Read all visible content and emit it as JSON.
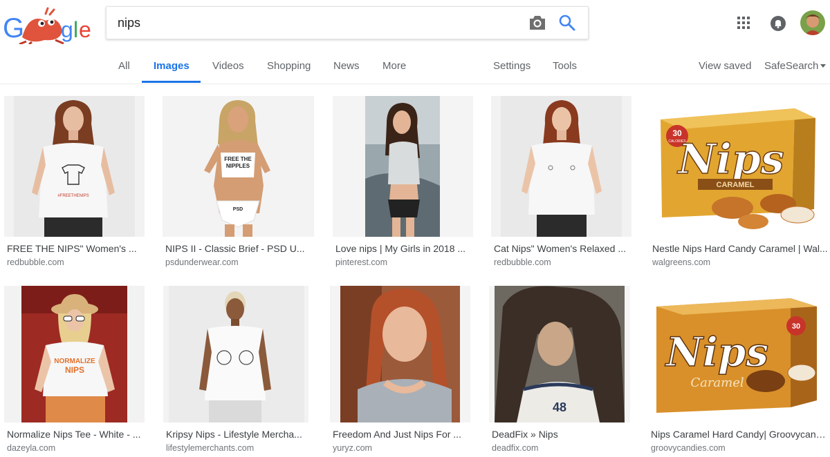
{
  "search": {
    "query": "nips"
  },
  "nav": {
    "tabs": [
      {
        "label": "All"
      },
      {
        "label": "Images"
      },
      {
        "label": "Videos"
      },
      {
        "label": "Shopping"
      },
      {
        "label": "News"
      },
      {
        "label": "More"
      }
    ],
    "settings": "Settings",
    "tools": "Tools",
    "view_saved": "View saved",
    "safesearch": "SafeSearch"
  },
  "results": [
    {
      "title": "FREE THE NIPS\" Women's ...",
      "source": "redbubble.com"
    },
    {
      "title": "NIPS II - Classic Brief - PSD U...",
      "source": "psdunderwear.com"
    },
    {
      "title": "Love nips | My Girls in 2018 ...",
      "source": "pinterest.com"
    },
    {
      "title": "Cat Nips\" Women's Relaxed ...",
      "source": "redbubble.com"
    },
    {
      "title": "Nestle Nips Hard Candy Caramel | Wal...",
      "source": "walgreens.com"
    },
    {
      "title": "Normalize Nips Tee - White - ...",
      "source": "dazeyla.com"
    },
    {
      "title": "Kripsy Nips - Lifestyle Mercha...",
      "source": "lifestylemerchants.com"
    },
    {
      "title": "Freedom And Just Nips For ...",
      "source": "yuryz.com"
    },
    {
      "title": "DeadFix » Nips",
      "source": "deadfix.com"
    },
    {
      "title": "Nips Caramel Hard Candy| Groovycand...",
      "source": "groovycandies.com"
    }
  ],
  "image_text": {
    "shirt_print": "#FREETHENIPS",
    "top_print_1": "FREE THE",
    "top_print_2": "NIPPLES",
    "brief_brand": "PSD",
    "box_brand": "Nips",
    "box_flavor": "CARAMEL",
    "box_calories": "30",
    "box_calories_unit": "CALORIES",
    "box2_flavor": "Caramel",
    "tee_print_1": "NORMALIZE",
    "tee_print_2": "NIPS",
    "jersey_number": "48"
  },
  "colors": {
    "accent": "#1a73e8",
    "text_muted": "#70757a",
    "box_gold": "#e2a630"
  }
}
